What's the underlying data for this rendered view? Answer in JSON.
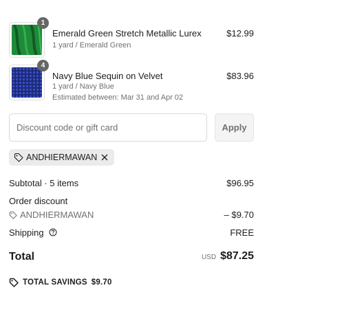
{
  "items": [
    {
      "name": "Emerald Green Stretch Metallic Lurex",
      "variant": "1 yard / Emerald Green",
      "quantity": "1",
      "price": "$12.99",
      "thumb_color": "#1f8a3a"
    },
    {
      "name": "Navy Blue Sequin on Velvet",
      "variant": "1 yard / Navy Blue",
      "estimate": "Estimated between: Mar 31 and Apr 02",
      "quantity": "4",
      "price": "$83.96",
      "thumb_color": "#24358f"
    }
  ],
  "discount": {
    "placeholder": "Discount code or gift card",
    "apply_label": "Apply",
    "applied_code": "ANDHIERMAWAN"
  },
  "summary": {
    "subtotal_label": "Subtotal · 5 items",
    "subtotal_value": "$96.95",
    "order_discount_label": "Order discount",
    "discount_code": "ANDHIERMAWAN",
    "discount_value": "– $9.70",
    "shipping_label": "Shipping",
    "shipping_value": "FREE",
    "total_label": "Total",
    "currency": "USD",
    "total_value": "$87.25",
    "savings_label": "TOTAL SAVINGS",
    "savings_value": "$9.70"
  },
  "icons": {
    "tag": "tag-icon",
    "remove": "close-icon",
    "help": "question-circle-icon"
  },
  "colors": {
    "text": "#1c1c1c",
    "muted": "#707070",
    "badge": "#666666",
    "chip_bg": "#ebebeb"
  }
}
